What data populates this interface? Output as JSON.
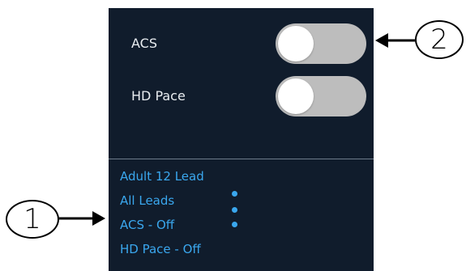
{
  "settings_panel": {
    "toggles": [
      {
        "label": "ACS",
        "state": "off"
      },
      {
        "label": "HD Pace",
        "state": "off"
      }
    ],
    "status_items": [
      "Adult 12 Lead",
      "All Leads",
      "ACS - Off",
      "HD Pace - Off"
    ],
    "more_menu_icon": "vertical-dots-icon"
  },
  "callouts": [
    {
      "number": "1",
      "text": "①"
    },
    {
      "number": "2",
      "text": "②"
    }
  ],
  "colors": {
    "panel_background": "#101c2c",
    "status_text": "#3aa7ee",
    "toggle_track": "#bdbdbd",
    "toggle_knob": "#ffffff",
    "label_text": "#e8ecf0"
  }
}
